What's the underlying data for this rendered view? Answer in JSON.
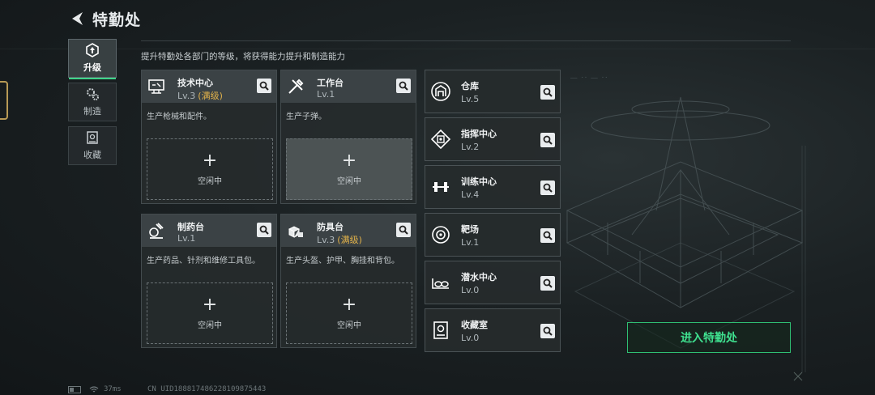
{
  "header": {
    "title": "特勤处"
  },
  "nav": [
    {
      "label": "升级",
      "icon": "upgrade-icon",
      "active": true
    },
    {
      "label": "制造",
      "icon": "gear-icon",
      "active": false
    },
    {
      "label": "收藏",
      "icon": "collection-icon",
      "active": false
    }
  ],
  "subtitle": "提升特勤处各部门的等级，将获得能力提升和制造能力",
  "big_cards": [
    {
      "name": "技术中心",
      "level": "Lv.3",
      "max": "(满级)",
      "desc": "生产枪械和配件。",
      "slot": {
        "plus": "+",
        "label": "空闲中"
      }
    },
    {
      "name": "工作台",
      "level": "Lv.1",
      "max": "",
      "desc": "生产子弹。",
      "slot": {
        "plus": "+",
        "label": "空闲中"
      }
    },
    {
      "name": "制药台",
      "level": "Lv.1",
      "max": "",
      "desc": "生产药品、针剂和维修工具包。",
      "slot": {
        "plus": "+",
        "label": "空闲中"
      }
    },
    {
      "name": "防具台",
      "level": "Lv.3",
      "max": "(满级)",
      "desc": "生产头盔、护甲、胸挂和背包。",
      "slot": {
        "plus": "+",
        "label": "空闲中"
      }
    }
  ],
  "small_cards": [
    {
      "name": "仓库",
      "level": "Lv.5"
    },
    {
      "name": "指挥中心",
      "level": "Lv.2"
    },
    {
      "name": "训练中心",
      "level": "Lv.4"
    },
    {
      "name": "靶场",
      "level": "Lv.1"
    },
    {
      "name": "潜水中心",
      "level": "Lv.0"
    },
    {
      "name": "收藏室",
      "level": "Lv.0"
    }
  ],
  "enter_button": "进入特勤处",
  "status": {
    "ping": "37ms",
    "uid": "CN UID18881748622810987544​3"
  },
  "colors": {
    "accent": "#3fe08f",
    "max_level": "#e2b24a",
    "bg": "#1b2123"
  }
}
